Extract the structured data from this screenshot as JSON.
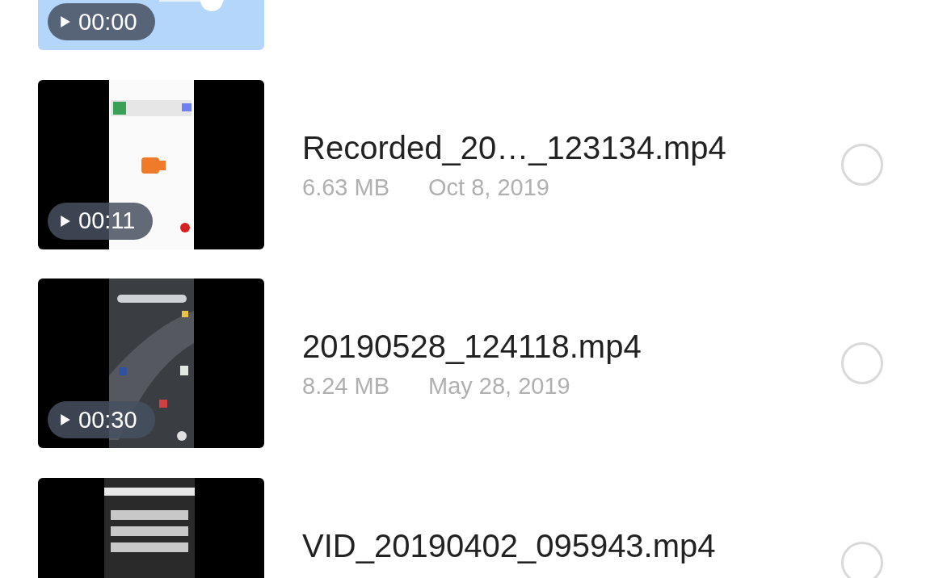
{
  "videos": [
    {
      "duration": "00:00"
    },
    {
      "duration": "00:11",
      "title": "Recorded_20…_123134.mp4",
      "size": "6.63 MB",
      "date": "Oct 8, 2019",
      "selected": false
    },
    {
      "duration": "00:30",
      "title": "20190528_124118.mp4",
      "size": "8.24 MB",
      "date": "May 28, 2019",
      "selected": false
    },
    {
      "title": "VID_20190402_095943.mp4",
      "selected": false
    }
  ]
}
